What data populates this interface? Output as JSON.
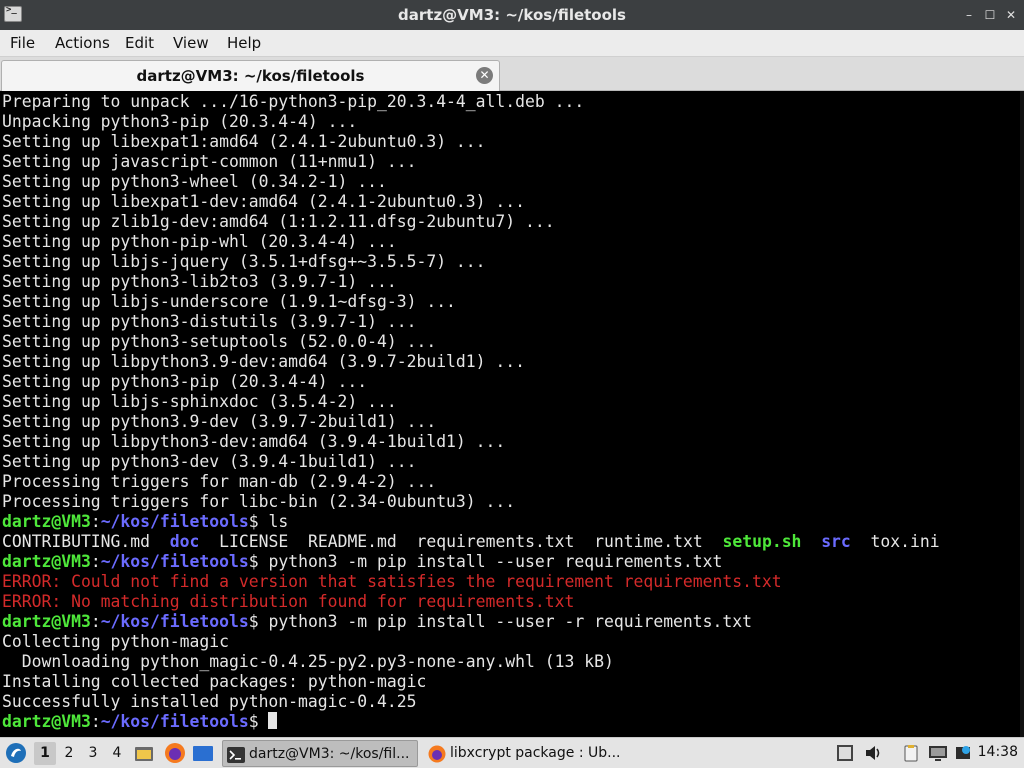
{
  "window": {
    "title": "dartz@VM3: ~/kos/filetools",
    "controls": {
      "minimize": "–",
      "maximize": "☐",
      "close": "✕"
    }
  },
  "menu": [
    "File",
    "Actions",
    "Edit",
    "View",
    "Help"
  ],
  "tab": {
    "label": "dartz@VM3: ~/kos/filetools",
    "close": "✕"
  },
  "terminal": {
    "lines": [
      {
        "type": "plain",
        "text": "Preparing to unpack .../16-python3-pip_20.3.4-4_all.deb ..."
      },
      {
        "type": "plain",
        "text": "Unpacking python3-pip (20.3.4-4) ..."
      },
      {
        "type": "plain",
        "text": "Setting up libexpat1:amd64 (2.4.1-2ubuntu0.3) ..."
      },
      {
        "type": "plain",
        "text": "Setting up javascript-common (11+nmu1) ..."
      },
      {
        "type": "plain",
        "text": "Setting up python3-wheel (0.34.2-1) ..."
      },
      {
        "type": "plain",
        "text": "Setting up libexpat1-dev:amd64 (2.4.1-2ubuntu0.3) ..."
      },
      {
        "type": "plain",
        "text": "Setting up zlib1g-dev:amd64 (1:1.2.11.dfsg-2ubuntu7) ..."
      },
      {
        "type": "plain",
        "text": "Setting up python-pip-whl (20.3.4-4) ..."
      },
      {
        "type": "plain",
        "text": "Setting up libjs-jquery (3.5.1+dfsg+~3.5.5-7) ..."
      },
      {
        "type": "plain",
        "text": "Setting up python3-lib2to3 (3.9.7-1) ..."
      },
      {
        "type": "plain",
        "text": "Setting up libjs-underscore (1.9.1~dfsg-3) ..."
      },
      {
        "type": "plain",
        "text": "Setting up python3-distutils (3.9.7-1) ..."
      },
      {
        "type": "plain",
        "text": "Setting up python3-setuptools (52.0.0-4) ..."
      },
      {
        "type": "plain",
        "text": "Setting up libpython3.9-dev:amd64 (3.9.7-2build1) ..."
      },
      {
        "type": "plain",
        "text": "Setting up python3-pip (20.3.4-4) ..."
      },
      {
        "type": "plain",
        "text": "Setting up libjs-sphinxdoc (3.5.4-2) ..."
      },
      {
        "type": "plain",
        "text": "Setting up python3.9-dev (3.9.7-2build1) ..."
      },
      {
        "type": "plain",
        "text": "Setting up libpython3-dev:amd64 (3.9.4-1build1) ..."
      },
      {
        "type": "plain",
        "text": "Setting up python3-dev (3.9.4-1build1) ..."
      },
      {
        "type": "plain",
        "text": "Processing triggers for man-db (2.9.4-2) ..."
      },
      {
        "type": "plain",
        "text": "Processing triggers for libc-bin (2.34-0ubuntu3) ..."
      },
      {
        "type": "prompt",
        "user": "dartz@VM3",
        "sep": ":",
        "path": "~/kos/filetools",
        "dollar": "$ ",
        "cmd": "ls"
      },
      {
        "type": "listing",
        "items": [
          {
            "text": "CONTRIBUTING.md",
            "kind": "file"
          },
          {
            "text": "doc",
            "kind": "dir"
          },
          {
            "text": "LICENSE",
            "kind": "file"
          },
          {
            "text": "README.md",
            "kind": "file"
          },
          {
            "text": "requirements.txt",
            "kind": "file"
          },
          {
            "text": "runtime.txt",
            "kind": "file"
          },
          {
            "text": "setup.sh",
            "kind": "exec"
          },
          {
            "text": "src",
            "kind": "dir"
          },
          {
            "text": "tox.ini",
            "kind": "file"
          }
        ]
      },
      {
        "type": "prompt",
        "user": "dartz@VM3",
        "sep": ":",
        "path": "~/kos/filetools",
        "dollar": "$ ",
        "cmd": "python3 -m pip install --user requirements.txt"
      },
      {
        "type": "error",
        "text": "ERROR: Could not find a version that satisfies the requirement requirements.txt"
      },
      {
        "type": "error",
        "text": "ERROR: No matching distribution found for requirements.txt"
      },
      {
        "type": "prompt",
        "user": "dartz@VM3",
        "sep": ":",
        "path": "~/kos/filetools",
        "dollar": "$ ",
        "cmd": "python3 -m pip install --user -r requirements.txt"
      },
      {
        "type": "plain",
        "text": "Collecting python-magic"
      },
      {
        "type": "plain",
        "text": "  Downloading python_magic-0.4.25-py2.py3-none-any.whl (13 kB)"
      },
      {
        "type": "plain",
        "text": "Installing collected packages: python-magic"
      },
      {
        "type": "plain",
        "text": "Successfully installed python-magic-0.4.25"
      },
      {
        "type": "prompt",
        "user": "dartz@VM3",
        "sep": ":",
        "path": "~/kos/filetools",
        "dollar": "$ ",
        "cmd": "",
        "cursor": true
      }
    ]
  },
  "taskbar": {
    "workspaces": [
      "1",
      "2",
      "3",
      "4"
    ],
    "tasks": [
      {
        "label": "dartz@VM3: ~/kos/fil...",
        "icon": "terminal-icon",
        "active": true
      },
      {
        "label": "libxcrypt package : Ub...",
        "icon": "firefox-icon",
        "active": false
      }
    ],
    "clock": "14:38"
  },
  "colors": {
    "prompt_user": "#4ee83a",
    "prompt_path": "#6b6bff",
    "error": "#d42a2a",
    "terminal_bg": "#000000"
  }
}
